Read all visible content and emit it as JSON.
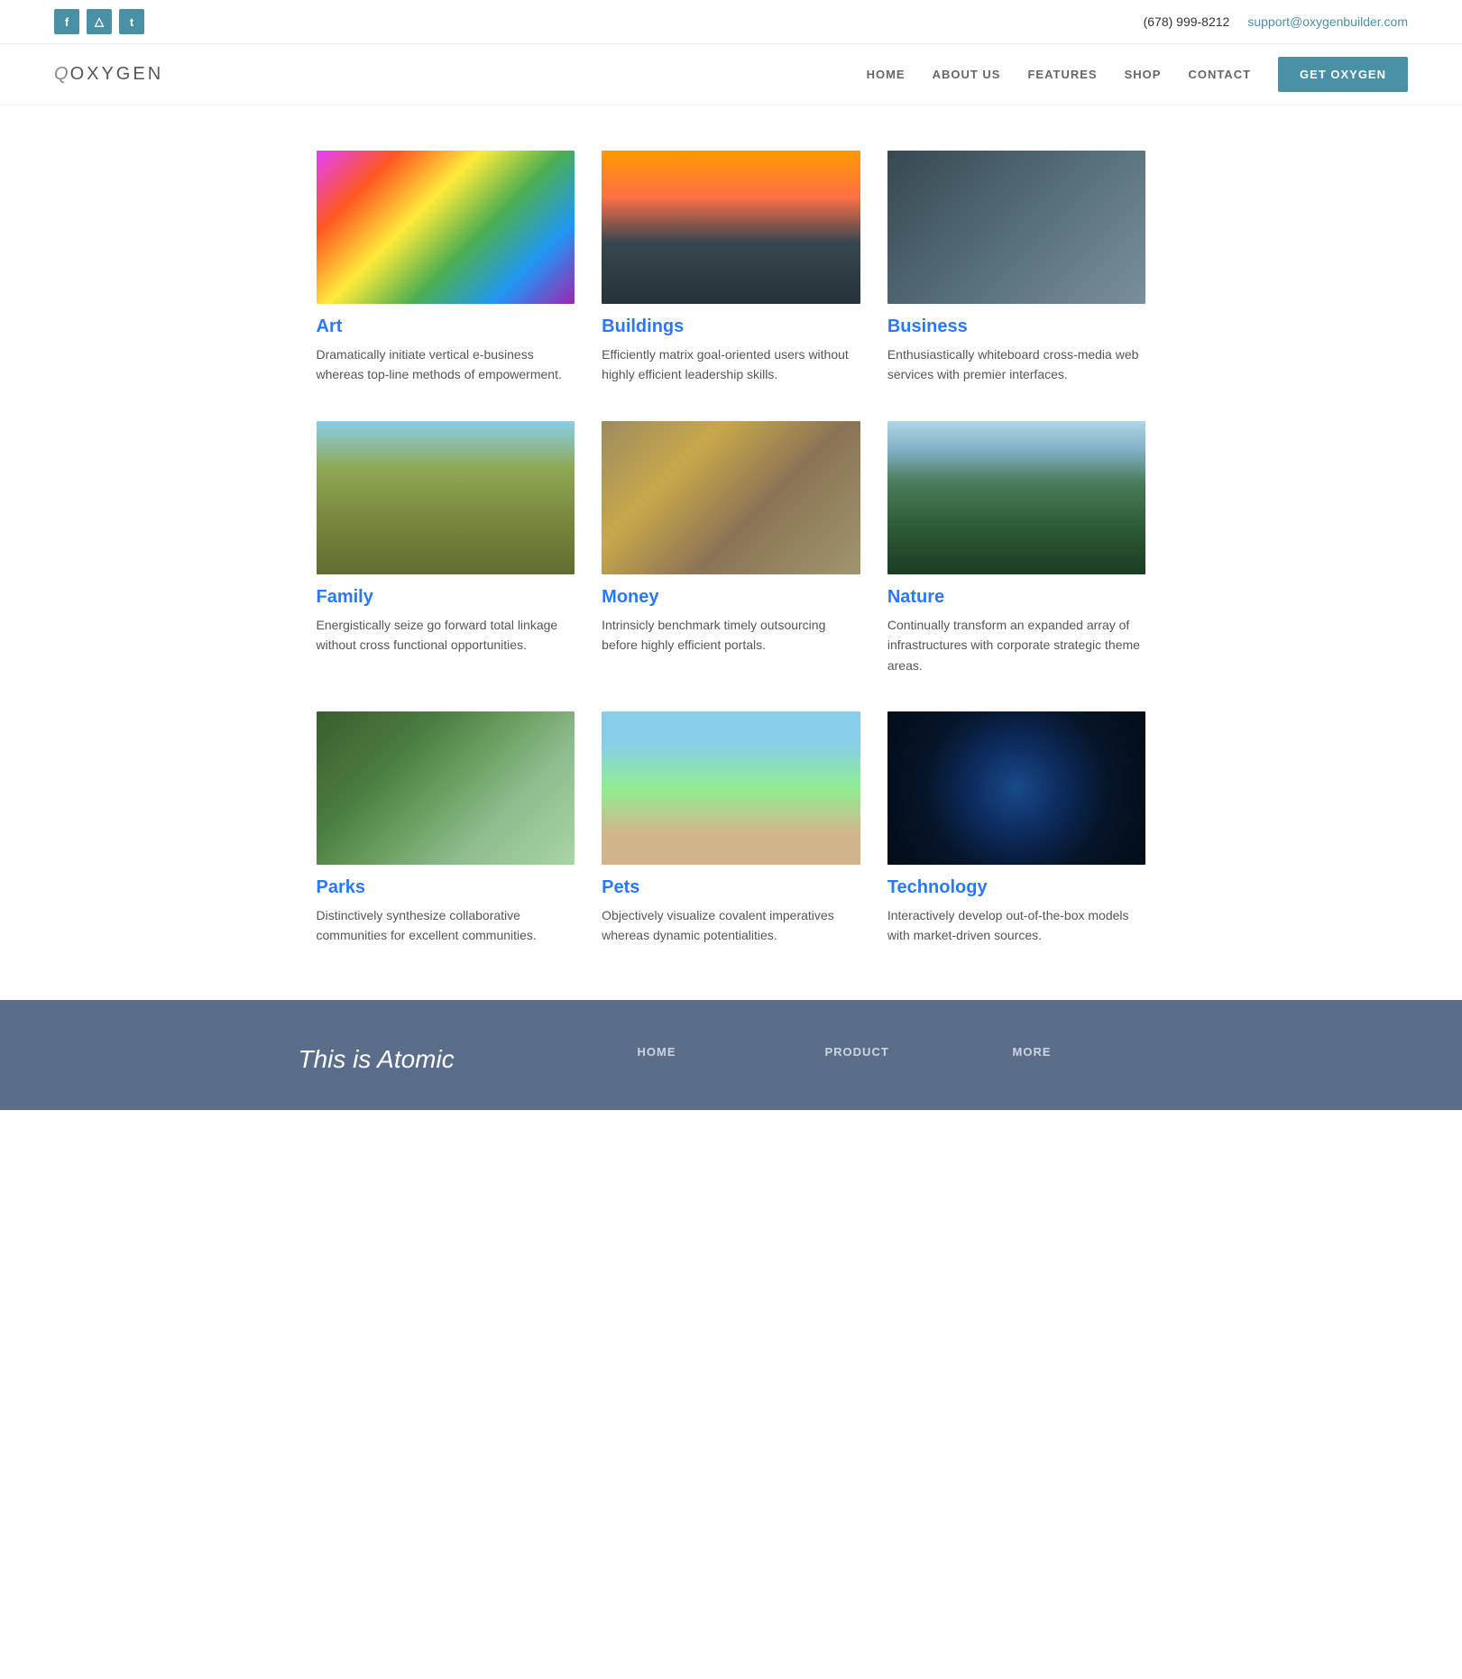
{
  "topbar": {
    "phone": "(678) 999-8212",
    "email": "support@oxygenbuilder.com",
    "social": [
      {
        "name": "facebook",
        "label": "f"
      },
      {
        "name": "instagram",
        "label": "i"
      },
      {
        "name": "twitter",
        "label": "t"
      }
    ]
  },
  "header": {
    "logo": "OXYGEN",
    "nav": [
      {
        "label": "HOME",
        "id": "home"
      },
      {
        "label": "ABOUT US",
        "id": "about"
      },
      {
        "label": "FEATURES",
        "id": "features"
      },
      {
        "label": "SHOP",
        "id": "shop"
      },
      {
        "label": "CONTACT",
        "id": "contact"
      }
    ],
    "cta": "GET OXYGEN"
  },
  "grid": {
    "items": [
      {
        "id": "art",
        "title": "Art",
        "desc": "Dramatically initiate vertical e-business whereas top-line methods of empowerment.",
        "img_class": "img-art"
      },
      {
        "id": "buildings",
        "title": "Buildings",
        "desc": "Efficiently matrix goal-oriented users without highly efficient leadership skills.",
        "img_class": "img-buildings"
      },
      {
        "id": "business",
        "title": "Business",
        "desc": "Enthusiastically whiteboard cross-media web services with premier interfaces.",
        "img_class": "img-business"
      },
      {
        "id": "family",
        "title": "Family",
        "desc": "Energistically seize go forward total linkage without cross functional opportunities.",
        "img_class": "img-family"
      },
      {
        "id": "money",
        "title": "Money",
        "desc": "Intrinsicly benchmark timely outsourcing before highly efficient portals.",
        "img_class": "img-money"
      },
      {
        "id": "nature",
        "title": "Nature",
        "desc": "Continually transform an expanded array of infrastructures with corporate strategic theme areas.",
        "img_class": "img-nature"
      },
      {
        "id": "parks",
        "title": "Parks",
        "desc": "Distinctively synthesize collaborative communities for excellent communities.",
        "img_class": "img-parks"
      },
      {
        "id": "pets",
        "title": "Pets",
        "desc": "Objectively visualize covalent imperatives whereas dynamic potentialities.",
        "img_class": "img-pets"
      },
      {
        "id": "technology",
        "title": "Technology",
        "desc": "Interactively develop out-of-the-box models with market-driven sources.",
        "img_class": "img-technology"
      }
    ]
  },
  "footer": {
    "brand": "This is Atomic",
    "columns": [
      {
        "title": "HOME",
        "links": []
      },
      {
        "title": "PRODUCT",
        "links": []
      },
      {
        "title": "MORE",
        "links": []
      }
    ]
  }
}
